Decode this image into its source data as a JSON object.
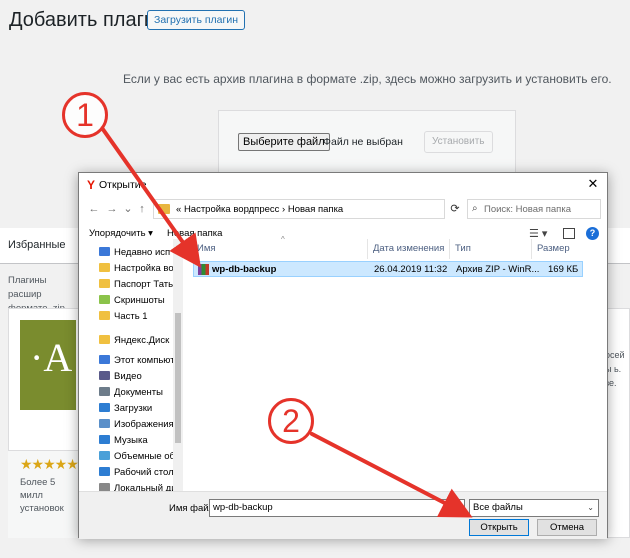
{
  "wp": {
    "page_title": "Добавить плагины",
    "upload_button": "Загрузить плагин",
    "description": "Если у вас есть архив плагина в формате .zip, здесь можно загрузить и установить его.",
    "choose_file": "Выберите файл",
    "file_status": "Файл не выбран",
    "install_button": "Установить",
    "tab_featured": "Избранные",
    "plugins_text": "Плагины расшир формате .zip, наж",
    "card_letter": "·A",
    "stars": "★★★★★",
    "installs": "Более 5 милл установок",
    "right_fragment": "осей ы ь. зе."
  },
  "dialog": {
    "title": "Открытие",
    "close": "✕",
    "nav": {
      "back": "←",
      "forward": "→",
      "recent": "⌄",
      "up": "↑"
    },
    "address": {
      "prefix": "«",
      "part1": "Настройка вордпресс",
      "part2": "Новая папка",
      "refresh": "⟳"
    },
    "search_placeholder": "Поиск: Новая папка",
    "toolbar": {
      "organize": "Упорядочить ▾",
      "new_folder": "Новая папка"
    },
    "nav_items": [
      {
        "label": "Недавно исп",
        "color": "#3b78d8"
      },
      {
        "label": "Настройка ворд",
        "color": "#f0c040"
      },
      {
        "label": "Паспорт Татьян",
        "color": "#f0c040"
      },
      {
        "label": "Скриншоты",
        "color": "#8bc34a"
      },
      {
        "label": "Часть 1",
        "color": "#f0c040"
      },
      {
        "label": "Яндекс.Диск",
        "color": "#f0c040"
      },
      {
        "label": "Этот компьютер",
        "color": "#3b78d8"
      },
      {
        "label": "Видео",
        "color": "#5a5a8a"
      },
      {
        "label": "Документы",
        "color": "#6d7c8a"
      },
      {
        "label": "Загрузки",
        "color": "#2d7dd2"
      },
      {
        "label": "Изображения",
        "color": "#5a8fc9"
      },
      {
        "label": "Музыка",
        "color": "#2d7dd2"
      },
      {
        "label": "Объемные объ",
        "color": "#4aa0d8"
      },
      {
        "label": "Рабочий стол",
        "color": "#2d7dd2"
      },
      {
        "label": "Локальный дис",
        "color": "#888888"
      }
    ],
    "columns": {
      "name": "Имя",
      "date": "Дата изменения",
      "type": "Тип",
      "size": "Размер"
    },
    "file": {
      "name": "wp-db-backup",
      "date": "26.04.2019 11:32",
      "type": "Архив ZIP - WinR...",
      "size": "169 КБ"
    },
    "filename_label": "Имя файла:",
    "filename_value": "wp-db-backup",
    "filetype": "Все файлы",
    "open_button": "Открыть",
    "cancel_button": "Отмена"
  },
  "annotations": {
    "step1": "1",
    "step2": "2",
    "arrow_color": "#e5332a"
  }
}
